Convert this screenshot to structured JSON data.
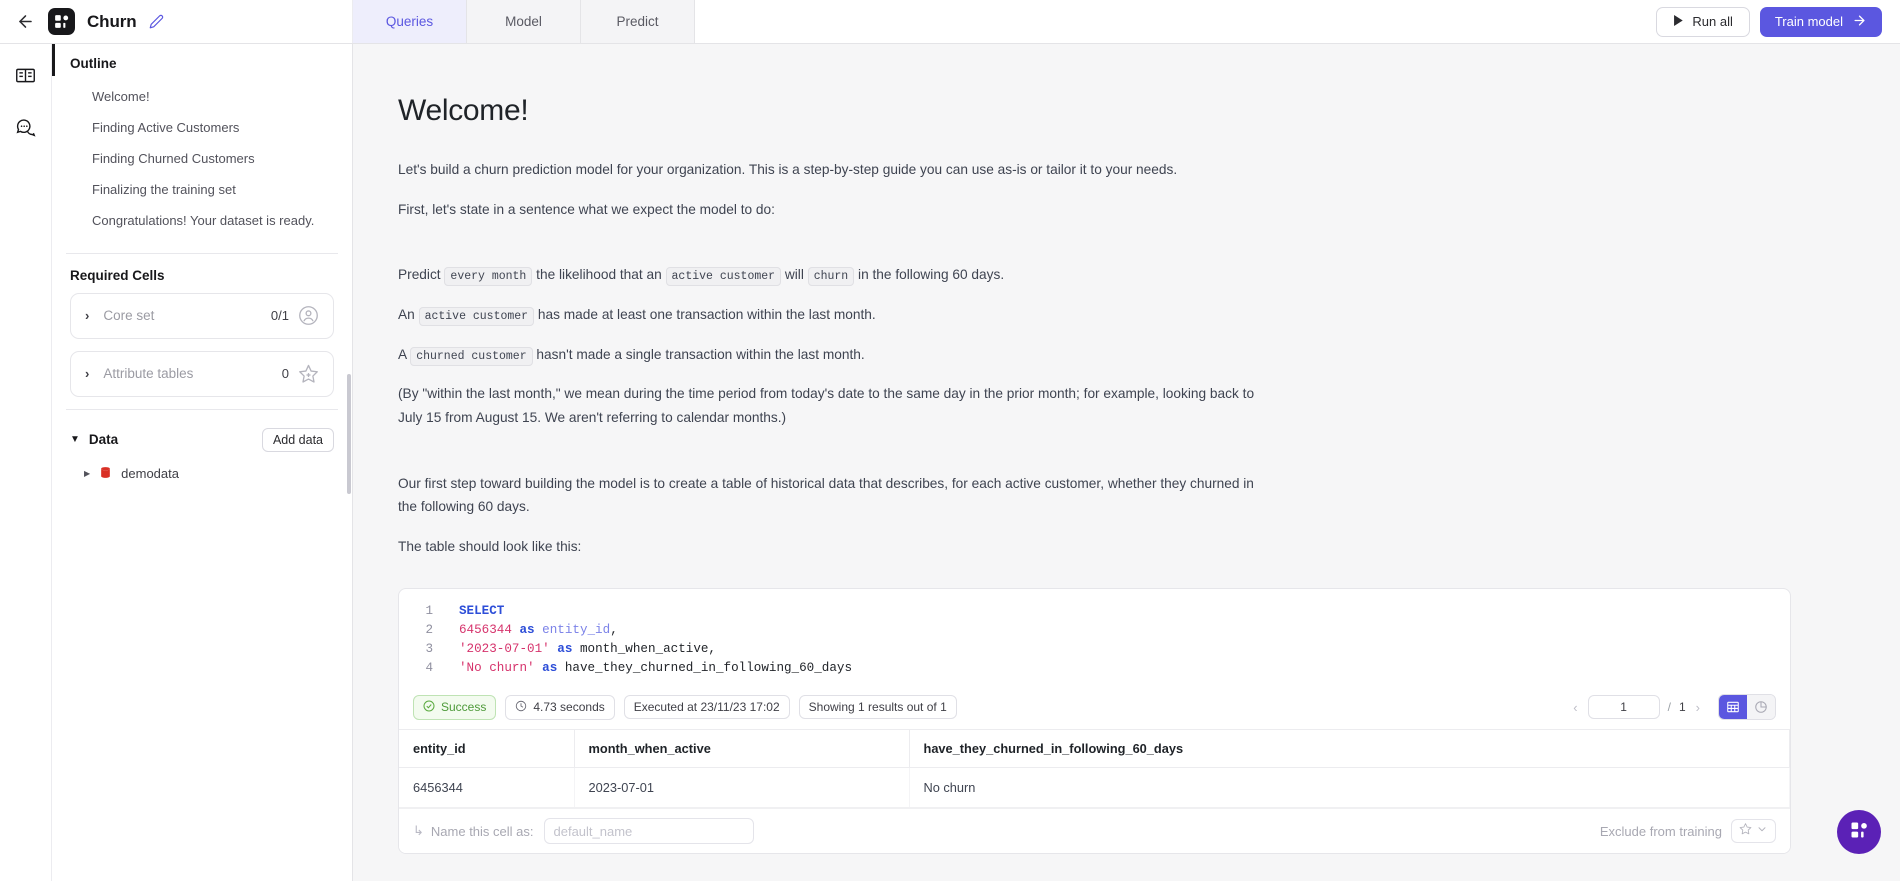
{
  "topbar": {
    "back_icon": "arrow-left-icon",
    "logo_icon": "app-logo-icon",
    "project_title": "Churn",
    "edit_icon": "pencil-icon",
    "tabs": [
      {
        "label": "Queries",
        "active": true
      },
      {
        "label": "Model",
        "active": false
      },
      {
        "label": "Predict",
        "active": false
      }
    ],
    "run_all_label": "Run all",
    "run_all_icon": "play-icon",
    "train_model_label": "Train model",
    "train_model_icon": "arrow-right-icon",
    "accent_color": "#5b57e0"
  },
  "rail": {
    "items": [
      {
        "icon": "book-icon",
        "active": true
      },
      {
        "icon": "chat-bubble-icon",
        "active": false
      }
    ]
  },
  "sidebar": {
    "outline_heading": "Outline",
    "outline_items": [
      {
        "label": "Welcome!"
      },
      {
        "label": "Finding Active Customers"
      },
      {
        "label": "Finding Churned Customers"
      },
      {
        "label": "Finalizing the training set"
      },
      {
        "label": "Congratulations! Your dataset is ready."
      }
    ],
    "required_heading": "Required Cells",
    "required_cells": [
      {
        "label": "Core set",
        "count": "0/1",
        "icon": "person-circle-icon",
        "chevron": "chevron-right-icon"
      },
      {
        "label": "Attribute tables",
        "count": "0",
        "icon": "star-icon",
        "chevron": "chevron-right-icon"
      }
    ],
    "data_heading": "Data",
    "data_caret": "caret-down-icon",
    "add_data_label": "Add data",
    "data_items": [
      {
        "label": "demodata",
        "icon": "database-icon",
        "caret": "caret-right-icon"
      }
    ]
  },
  "main": {
    "title": "Welcome!",
    "paragraphs": {
      "p1": "Let's build a churn prediction model for your organization. This is a step-by-step guide you can use as-is or tailor it to your needs.",
      "p2": "First, let's state in a sentence what we expect the model to do:",
      "p3_a": "Predict",
      "p3_chip1": "every month",
      "p3_b": "the likelihood that an",
      "p3_chip2": "active customer",
      "p3_c": "will",
      "p3_chip3": "churn",
      "p3_d": "in the following 60 days.",
      "p4_a": "An",
      "p4_chip": "active customer",
      "p4_b": "has made at least one transaction within the last month.",
      "p5_a": "A",
      "p5_chip": "churned customer",
      "p5_b": "hasn't made a single transaction within the last month.",
      "p6": "(By \"within the last month,\" we mean during the time period from today's date to the same day in the prior month; for example, looking back to July 15 from August 15. We aren't referring to calendar months.)",
      "p7": "Our first step toward building the model is to create a table of historical data that describes, for each active customer, whether they churned in the following 60 days.",
      "p8": "The table should look like this:"
    }
  },
  "cell": {
    "code_lines": [
      {
        "n": "1",
        "tokens": [
          {
            "t": "SELECT",
            "c": "k"
          }
        ]
      },
      {
        "n": "2",
        "tokens": [
          {
            "t": "6456344",
            "c": "num"
          },
          {
            "t": " ",
            "c": "pl"
          },
          {
            "t": "as",
            "c": "k"
          },
          {
            "t": " ",
            "c": "pl"
          },
          {
            "t": "entity_id",
            "c": "id"
          },
          {
            "t": ",",
            "c": "pl"
          }
        ]
      },
      {
        "n": "3",
        "tokens": [
          {
            "t": "'2023-07-01'",
            "c": "str"
          },
          {
            "t": " ",
            "c": "pl"
          },
          {
            "t": "as",
            "c": "k"
          },
          {
            "t": " ",
            "c": "pl"
          },
          {
            "t": "month_when_active,",
            "c": "pl"
          }
        ]
      },
      {
        "n": "4",
        "tokens": [
          {
            "t": "'No churn'",
            "c": "str"
          },
          {
            "t": " ",
            "c": "pl"
          },
          {
            "t": "as",
            "c": "k"
          },
          {
            "t": " ",
            "c": "pl"
          },
          {
            "t": "have_they_churned_in_following_60_days",
            "c": "pl"
          }
        ]
      }
    ],
    "status": {
      "success_label": "Success",
      "success_icon": "check-circle-icon",
      "duration_label": "4.73 seconds",
      "duration_icon": "clock-icon",
      "executed_label": "Executed at 23/11/23 17:02",
      "results_label": "Showing 1 results out of 1"
    },
    "pager": {
      "prev_icon": "chevron-left-icon",
      "next_icon": "chevron-right-icon",
      "current_page": "1",
      "separator": "/",
      "total_pages": "1",
      "table_view_icon": "table-grid-icon",
      "chart_view_icon": "pie-chart-icon"
    },
    "table": {
      "columns": [
        "entity_id",
        "month_when_active",
        "have_they_churned_in_following_60_days"
      ],
      "rows": [
        [
          "6456344",
          "2023-07-01",
          "No churn"
        ]
      ]
    },
    "footer": {
      "arrow_icon": "corner-down-right-icon",
      "name_label": "Name this cell as:",
      "name_value": "",
      "name_placeholder": "default_name",
      "exclude_label": "Exclude from training",
      "star_icon": "star-icon",
      "chevron_icon": "chevron-down-icon"
    }
  },
  "fab": {
    "icon": "assistant-logo-icon",
    "color": "#5b21b6"
  }
}
